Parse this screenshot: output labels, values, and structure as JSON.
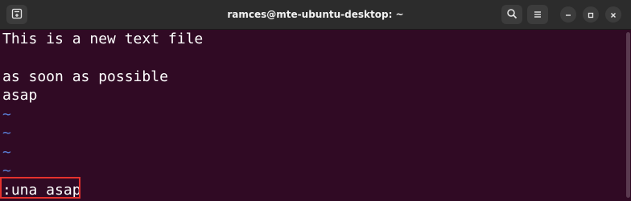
{
  "window": {
    "title": "ramces@mte-ubuntu-desktop: ~"
  },
  "icons": {
    "new_tab": "new-tab-icon",
    "search": "search-icon",
    "menu": "hamburger-menu-icon",
    "minimize": "minimize-icon",
    "maximize": "maximize-icon",
    "close": "close-icon"
  },
  "terminal": {
    "lines": [
      "This is a new text file",
      "",
      "as soon as possible",
      "asap"
    ],
    "tildes": [
      "~",
      "~",
      "~",
      "~"
    ],
    "command": ":una asap"
  },
  "colors": {
    "background": "#300a24",
    "text": "#ffffff",
    "tilde": "#5a7fd6",
    "highlight": "#e5322d"
  }
}
